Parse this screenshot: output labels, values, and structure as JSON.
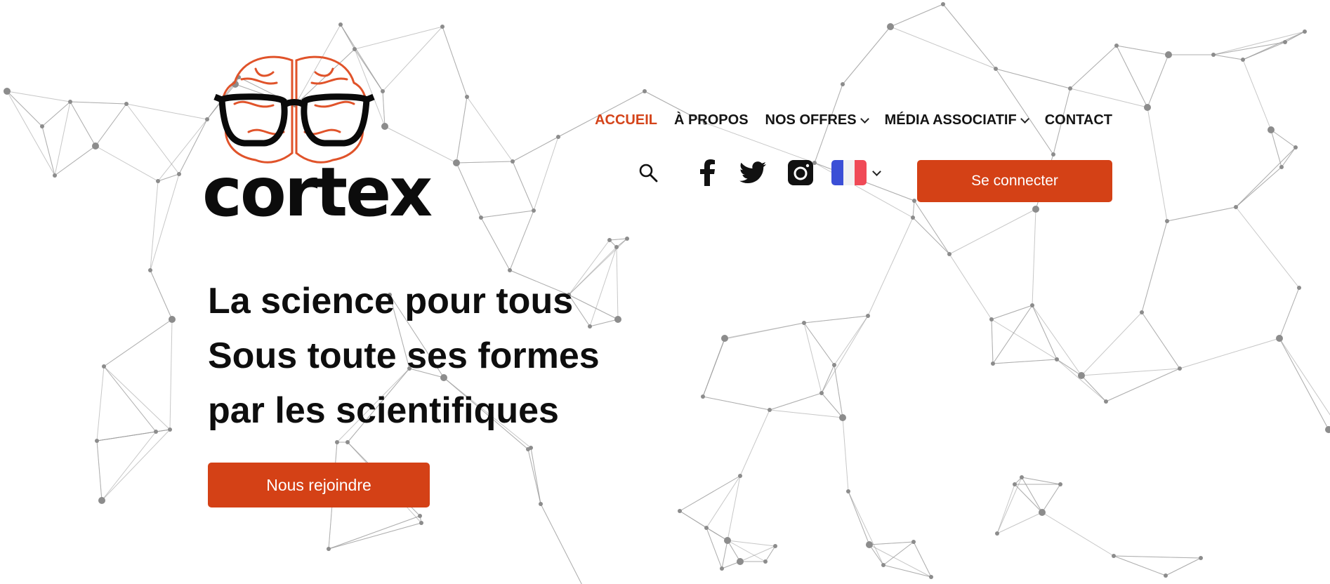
{
  "brand": {
    "name": "cortex"
  },
  "nav": {
    "items": [
      {
        "label": "ACCUEIL",
        "active": true,
        "dropdown": false
      },
      {
        "label": "À PROPOS",
        "active": false,
        "dropdown": false
      },
      {
        "label": "NOS OFFRES",
        "active": false,
        "dropdown": true
      },
      {
        "label": "MÉDIA ASSOCIATIF",
        "active": false,
        "dropdown": true
      },
      {
        "label": "CONTACT",
        "active": false,
        "dropdown": false
      }
    ]
  },
  "toolbar": {
    "icons": [
      "search-icon",
      "facebook-icon",
      "twitter-icon",
      "instagram-icon",
      "flag-fr-icon"
    ],
    "login_label": "Se connecter"
  },
  "hero": {
    "line1": "La science pour tous",
    "line2": "Sous toute ses formes",
    "line3": "par les scientifiques",
    "cta_label": "Nous rejoindre"
  },
  "colors": {
    "accent": "#d44116",
    "text": "#111111",
    "network": "#8c8c8c"
  }
}
